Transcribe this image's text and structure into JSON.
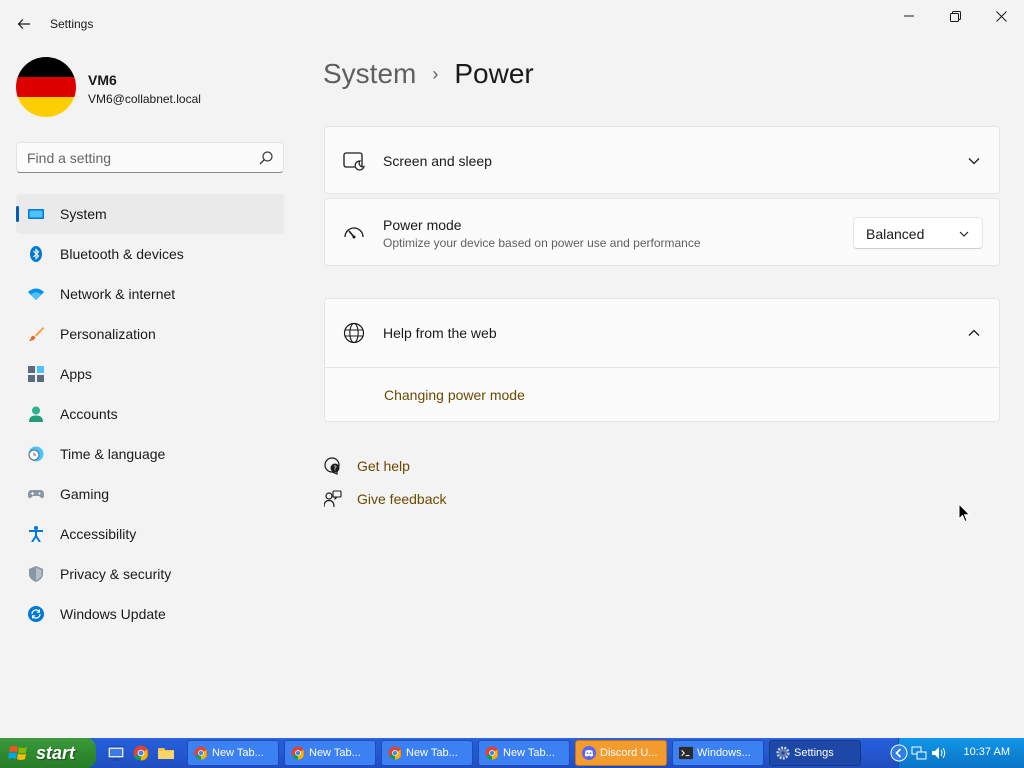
{
  "window": {
    "title": "Settings"
  },
  "profile": {
    "name": "VM6",
    "email": "VM6@collabnet.local"
  },
  "search": {
    "placeholder": "Find a setting"
  },
  "nav": {
    "items": [
      {
        "label": "System",
        "icon": "system-icon",
        "active": true
      },
      {
        "label": "Bluetooth & devices",
        "icon": "bluetooth-icon"
      },
      {
        "label": "Network & internet",
        "icon": "wifi-icon"
      },
      {
        "label": "Personalization",
        "icon": "brush-icon"
      },
      {
        "label": "Apps",
        "icon": "apps-icon"
      },
      {
        "label": "Accounts",
        "icon": "person-icon"
      },
      {
        "label": "Time & language",
        "icon": "clock-globe-icon"
      },
      {
        "label": "Gaming",
        "icon": "gamepad-icon"
      },
      {
        "label": "Accessibility",
        "icon": "accessibility-icon"
      },
      {
        "label": "Privacy & security",
        "icon": "shield-icon"
      },
      {
        "label": "Windows Update",
        "icon": "update-icon"
      }
    ]
  },
  "breadcrumb": {
    "parent": "System",
    "separator": "›",
    "current": "Power"
  },
  "cards": {
    "screen_sleep": {
      "title": "Screen and sleep"
    },
    "power_mode": {
      "title": "Power mode",
      "subtitle": "Optimize your device based on power use and performance",
      "value": "Balanced"
    },
    "help": {
      "title": "Help from the web",
      "link": "Changing power mode"
    }
  },
  "footer": {
    "get_help": "Get help",
    "give_feedback": "Give feedback"
  },
  "taskbar": {
    "start_label": "start",
    "buttons": [
      {
        "label": "New Tab...",
        "icon": "chrome-icon",
        "style": "normal"
      },
      {
        "label": "New Tab...",
        "icon": "chrome-icon",
        "style": "normal"
      },
      {
        "label": "New Tab...",
        "icon": "chrome-icon",
        "style": "normal"
      },
      {
        "label": "New Tab...",
        "icon": "chrome-icon",
        "style": "normal"
      },
      {
        "label": "Discord U...",
        "icon": "discord-icon",
        "style": "orange"
      },
      {
        "label": "Windows...",
        "icon": "terminal-icon",
        "style": "normal"
      },
      {
        "label": "Settings",
        "icon": "gear-icon",
        "style": "active"
      }
    ],
    "clock": "10:37 AM"
  },
  "colors": {
    "accent": "#005fb8",
    "link": "#6b4a00",
    "xp_taskbar": "#245ddb",
    "xp_start": "#2f8a2f"
  }
}
